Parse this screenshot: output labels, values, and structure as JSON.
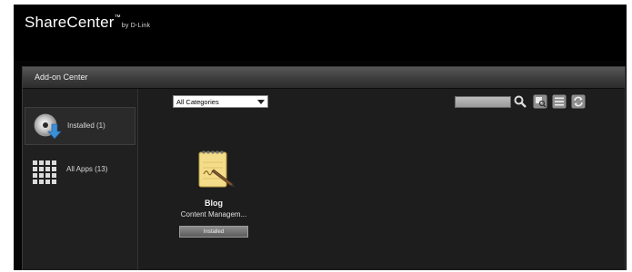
{
  "header": {
    "brand": "ShareCenter",
    "trademark": "™",
    "byline": "by D-Link"
  },
  "panel": {
    "title": "Add-on Center"
  },
  "sidebar": {
    "items": [
      {
        "label": "Installed (1)",
        "icon": "disc-download-icon",
        "active": true
      },
      {
        "label": "All Apps (13)",
        "icon": "grid-icon",
        "active": false
      }
    ]
  },
  "toolbar": {
    "category_select": "All Categories",
    "search_value": "",
    "icons": [
      "search-icon",
      "app-search-icon",
      "list-view-icon",
      "refresh-icon"
    ]
  },
  "apps": [
    {
      "name": "Blog",
      "description": "Content Managem...",
      "status": "Installed",
      "icon": "notepad-pencil-icon"
    }
  ],
  "colors": {
    "background": "#050505",
    "panel_bg": "#1b1b1b",
    "tool_icon": "#8d8d8d"
  }
}
